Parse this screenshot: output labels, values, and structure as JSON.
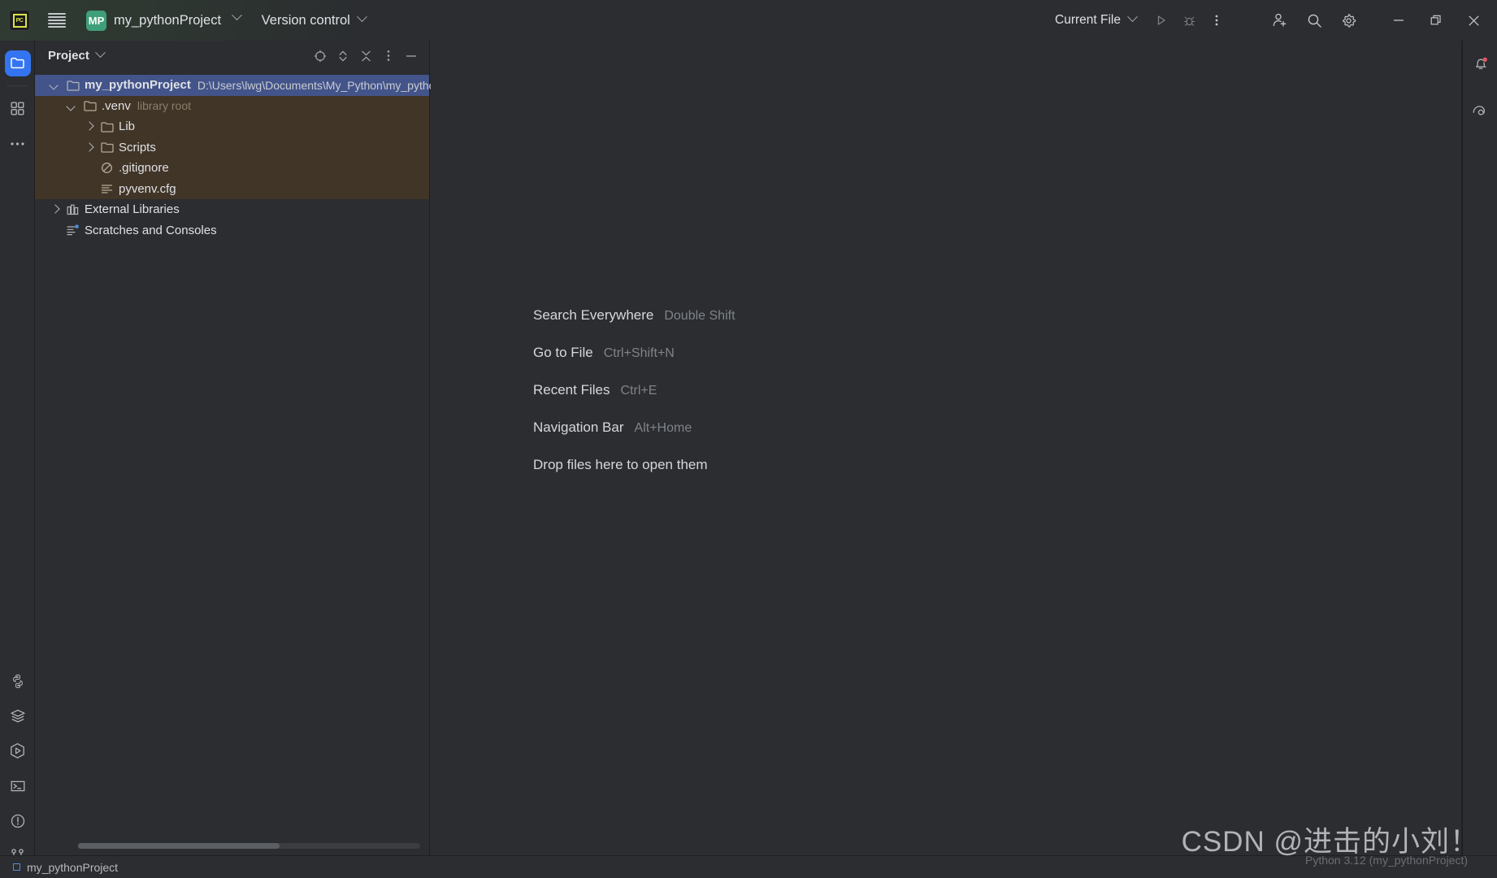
{
  "window": {
    "app_icon": "pycharm-logo-icon",
    "minimize_label": "minimize-icon",
    "maximize_label": "restore-icon",
    "close_label": "close-icon"
  },
  "toolbar": {
    "menu_icon": "hamburger-menu-icon",
    "project_badge": "MP",
    "project_name": "my_pythonProject",
    "version_control": "Version control",
    "run_config": "Current File",
    "run_icon": "run-icon",
    "debug_icon": "debug-icon",
    "more_icon": "more-vertical-icon",
    "account_icon": "add-account-icon",
    "search_icon": "search-icon",
    "settings_icon": "gear-icon"
  },
  "left_rail": [
    {
      "name": "project-tool-window",
      "icon": "folder-icon",
      "active": true
    },
    {
      "name": "structure-tool-window",
      "icon": "structure-grid-icon",
      "active": false
    },
    {
      "name": "more-tool-windows",
      "icon": "ellipsis-icon",
      "active": false
    }
  ],
  "left_rail_bottom": [
    {
      "name": "python-packages",
      "icon": "python-icon"
    },
    {
      "name": "database-tool-window",
      "icon": "layers-icon"
    },
    {
      "name": "run-tool-window",
      "icon": "run-hexagon-icon"
    },
    {
      "name": "terminal-tool-window",
      "icon": "terminal-icon"
    },
    {
      "name": "problems-tool-window",
      "icon": "warning-circle-icon"
    },
    {
      "name": "version-control-tool-window",
      "icon": "branch-icon"
    }
  ],
  "right_rail": [
    {
      "name": "notifications",
      "icon": "bell-icon",
      "badge": true
    },
    {
      "name": "ai-assistant",
      "icon": "spiral-icon",
      "badge": false
    }
  ],
  "panel": {
    "title": "Project",
    "chevron_icon": "chevron-down-icon",
    "actions": [
      {
        "name": "select-opened-file",
        "icon": "target-icon"
      },
      {
        "name": "expand-collapse",
        "icon": "expand-collapse-icon"
      },
      {
        "name": "collapse-all",
        "icon": "collapse-all-icon"
      },
      {
        "name": "panel-options",
        "icon": "more-vertical-icon"
      },
      {
        "name": "hide-panel",
        "icon": "minus-icon"
      }
    ]
  },
  "tree": [
    {
      "label": "my_pythonProject",
      "path": "D:\\Users\\lwg\\Documents\\My_Python\\my_python",
      "icon": "folder-icon",
      "arrow": "down",
      "indent": 0,
      "state": "selected",
      "bold": true
    },
    {
      "label": ".venv",
      "sub": "library root",
      "icon": "folder-icon",
      "arrow": "down",
      "indent": 1,
      "state": "venv"
    },
    {
      "label": "Lib",
      "icon": "folder-icon",
      "arrow": "right",
      "indent": 2,
      "state": "venv"
    },
    {
      "label": "Scripts",
      "icon": "folder-icon",
      "arrow": "right",
      "indent": 2,
      "state": "venv"
    },
    {
      "label": ".gitignore",
      "icon": "gitignore-icon",
      "arrow": "none",
      "indent": 2,
      "state": "venv"
    },
    {
      "label": "pyvenv.cfg",
      "icon": "config-file-icon",
      "arrow": "none",
      "indent": 2,
      "state": "venv"
    },
    {
      "label": "External Libraries",
      "icon": "library-icon",
      "arrow": "right",
      "indent": 0,
      "state": "normal"
    },
    {
      "label": "Scratches and Consoles",
      "icon": "scratches-icon",
      "arrow": "none",
      "indent": 0,
      "state": "normal"
    }
  ],
  "editor_hints": [
    {
      "label": "Search Everywhere",
      "shortcut": "Double Shift"
    },
    {
      "label": "Go to File",
      "shortcut": "Ctrl+Shift+N"
    },
    {
      "label": "Recent Files",
      "shortcut": "Ctrl+E"
    },
    {
      "label": "Navigation Bar",
      "shortcut": "Alt+Home"
    },
    {
      "label": "Drop files here to open them",
      "shortcut": ""
    }
  ],
  "watermark": "CSDN @进击的小刘！",
  "status_bar": {
    "project": "my_pythonProject",
    "interpreter": "Python 3.12 (my_pythonProject)"
  },
  "colors": {
    "background": "#2b2d30",
    "selection": "#43548a",
    "venv_highlight": "#413527",
    "accent": "#3574f0",
    "badge_green": "#3f9f7a",
    "notification_red": "#e55765"
  }
}
